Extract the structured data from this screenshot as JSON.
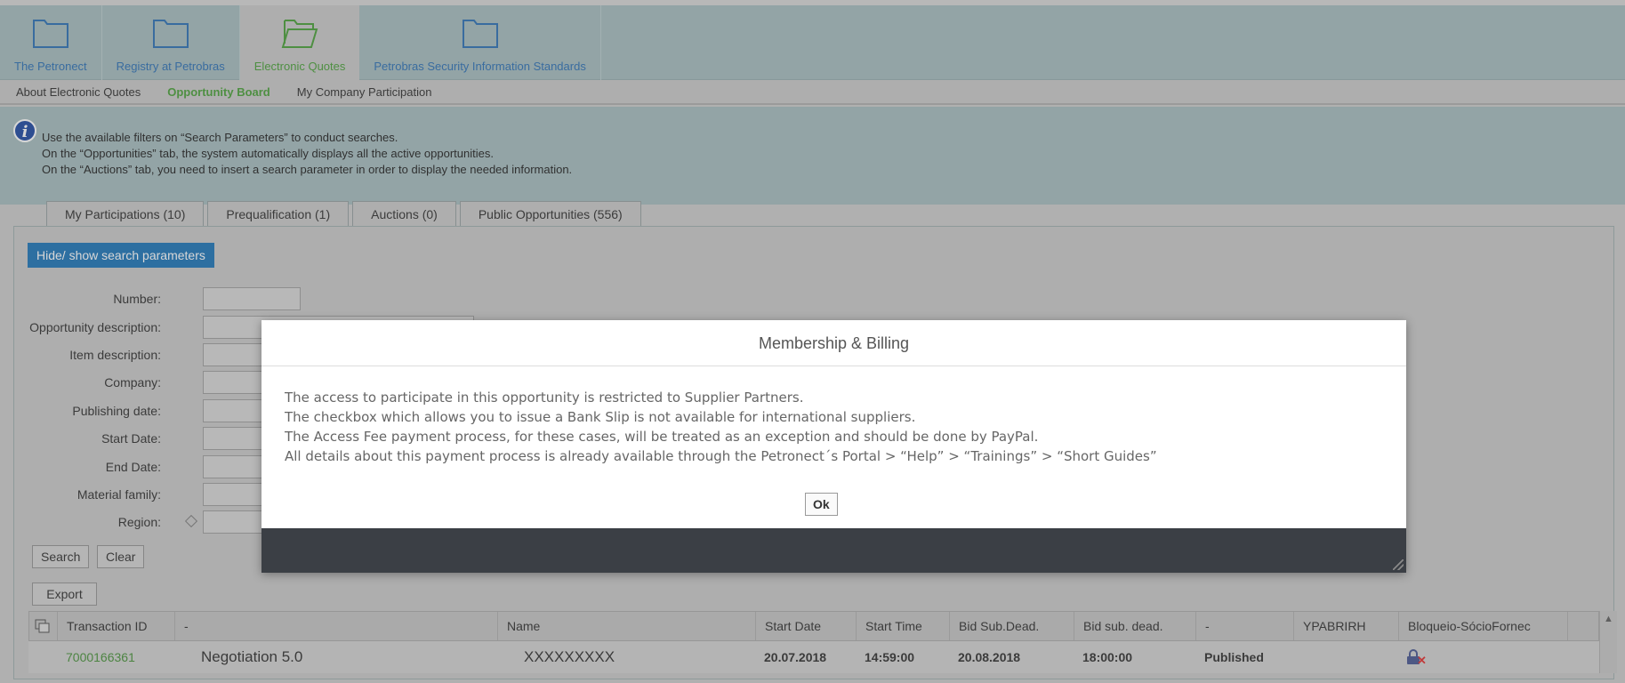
{
  "top_nav": [
    {
      "label": "The Petronect",
      "icon": "folder-icon",
      "active": false
    },
    {
      "label": "Registry at Petrobras",
      "icon": "folder-icon",
      "active": false
    },
    {
      "label": "Electronic Quotes",
      "icon": "folder-open-icon",
      "active": true
    },
    {
      "label": "Petrobras Security Information Standards",
      "icon": "folder-icon",
      "active": false
    }
  ],
  "sub_nav": [
    {
      "label": "About Electronic Quotes",
      "active": false
    },
    {
      "label": "Opportunity Board",
      "active": true
    },
    {
      "label": "My Company Participation",
      "active": false
    }
  ],
  "info": {
    "icon": "info-icon",
    "lines": [
      "Use the available filters on “Search Parameters” to conduct searches.",
      "On the “Opportunities” tab, the system automatically displays all the active opportunities.",
      "On the “Auctions” tab, you need to insert a search parameter in order to display the needed information."
    ]
  },
  "tabs": [
    "My Participations (10)",
    "Prequalification (1)",
    "Auctions (0)",
    "Public Opportunities (556)"
  ],
  "search": {
    "toggle_label": "Hide/ show search parameters",
    "fields": [
      "Number:",
      "Opportunity description:",
      "Item description:",
      "Company:",
      "Publishing date:",
      "Start Date:",
      "End Date:",
      "Material family:",
      "Region:"
    ],
    "search_label": "Search",
    "clear_label": "Clear",
    "export_label": "Export"
  },
  "table": {
    "headers": [
      "Transaction ID",
      "-",
      "Name",
      "Start Date",
      "Start Time",
      "Bid Sub.Dead.",
      "Bid sub. dead.",
      "-",
      "YPABRIRH",
      "Bloqueio-SócioFornec"
    ],
    "rows": [
      {
        "transaction_id": "7000166361",
        "description": "Negotiation 5.0",
        "name": "XXXXXXXXX",
        "start_date": "20.07.2018",
        "start_time": "14:59:00",
        "bid_sub_dead": "20.08.2018",
        "bid_sub_dead_time": "18:00:00",
        "status": "Published",
        "ypabrirh": "",
        "lock_icon": "lock-blocked-icon"
      }
    ]
  },
  "modal": {
    "title": "Membership & Billing",
    "lines": [
      "The access to participate in this opportunity is restricted to Supplier Partners.",
      "The checkbox which allows you to issue a Bank Slip is not available for international suppliers.",
      "The Access Fee payment process, for these cases, will be treated as an exception and should be done by PayPal.",
      "All details about this payment process is already available through the Petronect´s Portal > “Help” > “Trainings” > “Short Guides”"
    ],
    "ok_label": "Ok"
  },
  "colors": {
    "nav_bg": "#9fb8bb",
    "link_blue": "#1f67b1",
    "active_green": "#3d9a2c",
    "button_blue": "#0e6cb3",
    "modal_footer": "#3b3f45"
  }
}
